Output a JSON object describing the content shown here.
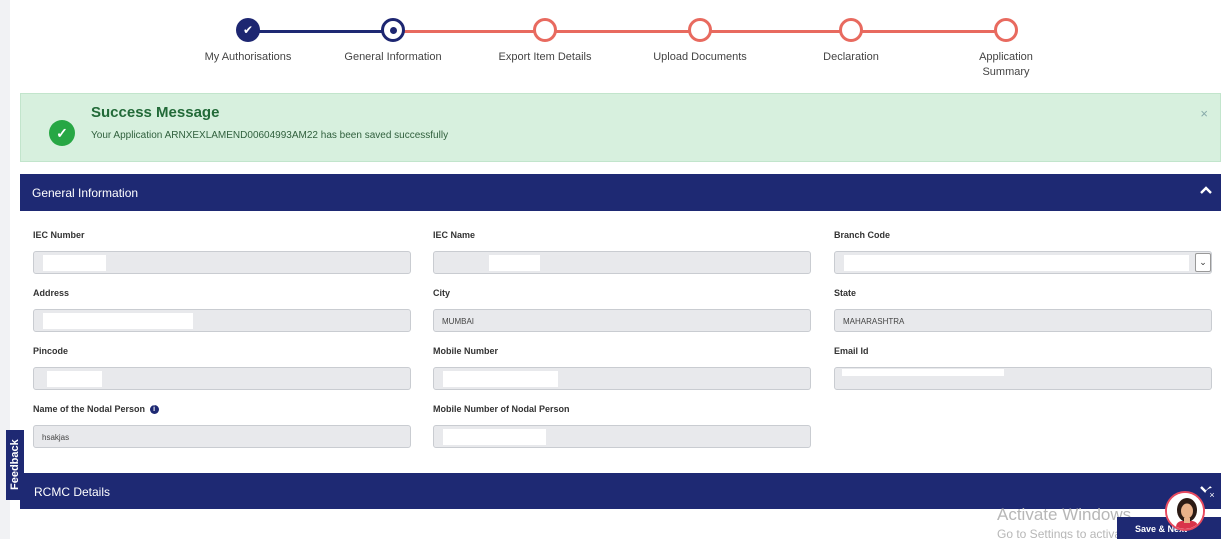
{
  "stepper": {
    "steps": [
      {
        "label": "My Authorisations",
        "state": "done"
      },
      {
        "label": "General Information",
        "state": "active"
      },
      {
        "label": "Export Item Details",
        "state": "todo"
      },
      {
        "label": "Upload Documents",
        "state": "todo"
      },
      {
        "label": "Declaration",
        "state": "todo"
      },
      {
        "label_line1": "Application",
        "label_line2": "Summary",
        "state": "todo"
      }
    ]
  },
  "alert": {
    "title": "Success Message",
    "text": "Your Application ARNXEXLAMEND00604993AM22 has been saved successfully",
    "close": "×"
  },
  "general_section": {
    "title": "General Information"
  },
  "form": {
    "iec_number": {
      "label": "IEC Number",
      "value": ""
    },
    "iec_name": {
      "label": "IEC Name",
      "value": ""
    },
    "branch_code": {
      "label": "Branch Code",
      "value": "",
      "caret": "⌄"
    },
    "address": {
      "label": "Address",
      "value": ""
    },
    "city": {
      "label": "City",
      "value": "MUMBAI"
    },
    "state": {
      "label": "State",
      "value": "MAHARASHTRA"
    },
    "pincode": {
      "label": "Pincode",
      "value": ""
    },
    "mobile": {
      "label": "Mobile Number",
      "value": ""
    },
    "email": {
      "label": "Email Id",
      "value": ""
    },
    "nodal_name": {
      "label": "Name of the Nodal Person",
      "value": "hsakjas",
      "info_icon": "i"
    },
    "nodal_mobile": {
      "label": "Mobile Number of Nodal Person",
      "value": ""
    }
  },
  "rcmc_section": {
    "title": "RCMC Details"
  },
  "feedback": {
    "label": "Feedback"
  },
  "watermark": {
    "title": "Activate Windows",
    "subtitle": "Go to Settings to activate Windows."
  },
  "save_button": {
    "label": "Save & Next"
  },
  "colors": {
    "primary": "#1e2973",
    "pending": "#e86a5f",
    "success": "#27a744",
    "success_bg": "#d7f0de"
  }
}
